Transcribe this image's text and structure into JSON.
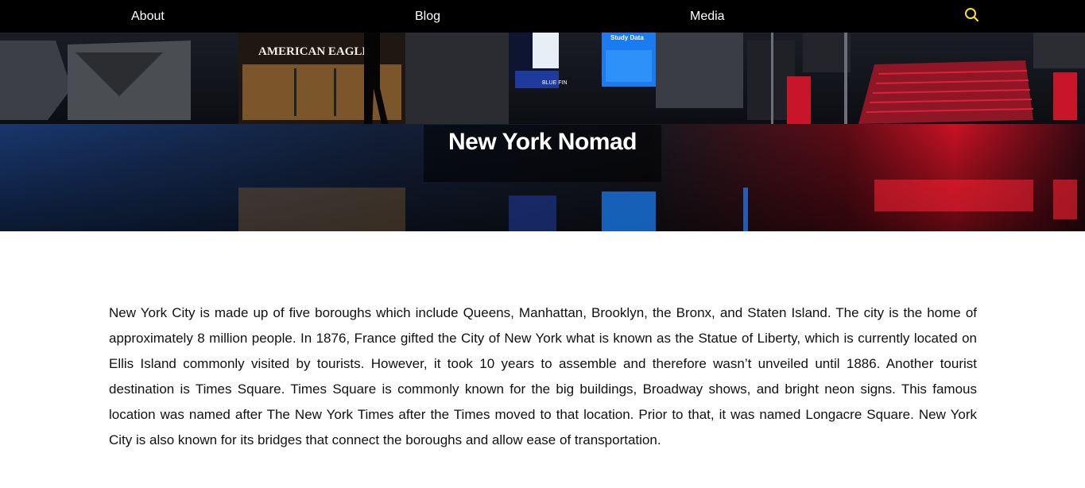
{
  "nav": {
    "items": [
      {
        "label": "About"
      },
      {
        "label": "Blog"
      },
      {
        "label": "Media"
      }
    ],
    "search_icon": "search-icon",
    "search_color": "#f5e02a"
  },
  "hero": {
    "title": "New York Nomad",
    "signs": {
      "store": "AMERICAN EAGLE",
      "screen": "Study Data",
      "brand": "BLUE FIN"
    }
  },
  "main": {
    "paragraph": "New York City is made up of five boroughs which include Queens, Manhattan, Brooklyn, the Bronx, and Staten Island. The city is the home of approximately 8 million people. In 1876, France gifted the City of New York what is known as the Statue of Liberty, which is currently located on Ellis Island commonly visited by tourists. However, it took 10 years to assemble and therefore wasn’t unveiled until 1886. Another tourist destination is Times Square. Times Square is commonly known for the big buildings, Broadway shows, and bright neon signs. This famous location was named after The New York Times after the Times moved to that location. Prior to that, it was named Longacre Square. New York City is also known for its bridges that connect the boroughs and allow ease of transportation."
  },
  "colors": {
    "nav_bg": "#000000",
    "accent_yellow": "#f5e02a",
    "neon_blue": "#1e6cff",
    "neon_red": "#ff1a2e"
  }
}
